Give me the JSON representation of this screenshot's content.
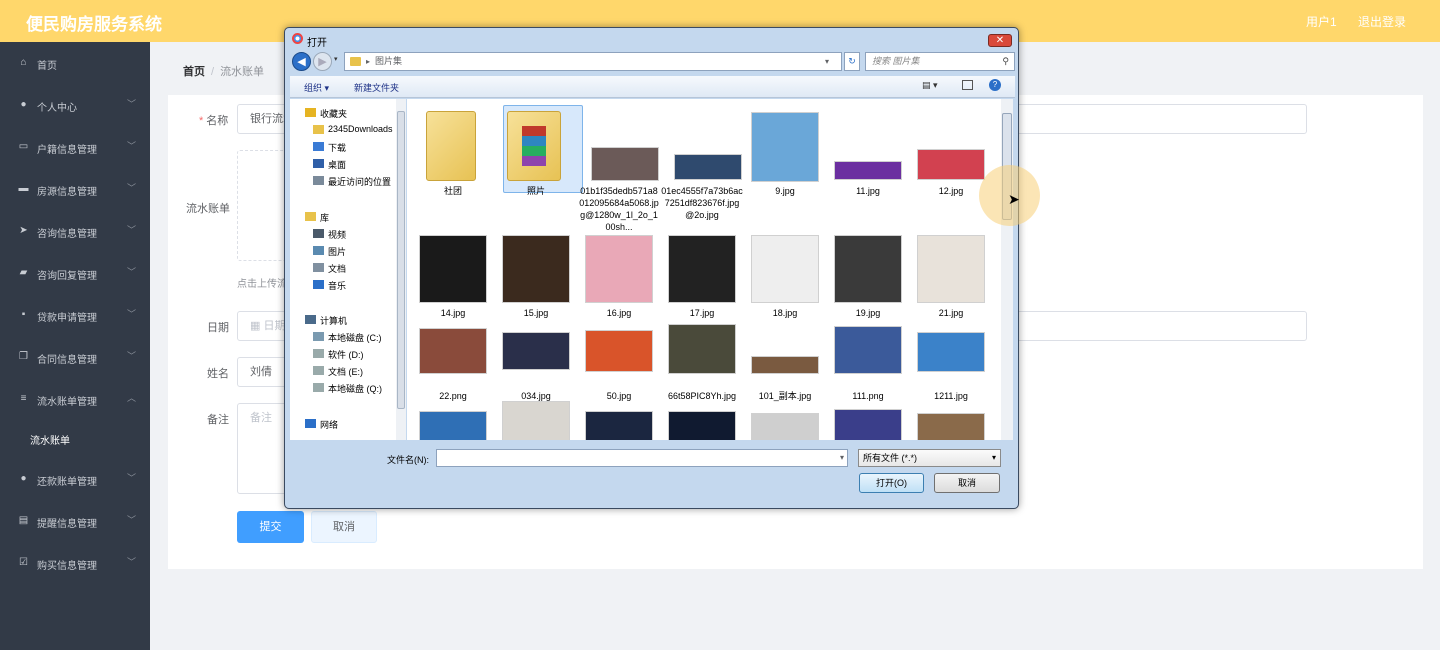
{
  "app": {
    "title": "便民购房服务系统",
    "user": "用户1",
    "logout": "退出登录"
  },
  "sidebar": {
    "items": [
      {
        "label": "首页",
        "icon": "home-icon",
        "glyph": "⌂",
        "expand": false
      },
      {
        "label": "个人中心",
        "icon": "user-icon",
        "glyph": "●",
        "expand": true
      },
      {
        "label": "户籍信息管理",
        "icon": "chat-icon",
        "glyph": "▭",
        "expand": true
      },
      {
        "label": "房源信息管理",
        "icon": "monitor-icon",
        "glyph": "▬",
        "expand": true
      },
      {
        "label": "咨询信息管理",
        "icon": "send-icon",
        "glyph": "➤",
        "expand": true
      },
      {
        "label": "咨询回复管理",
        "icon": "thumb-icon",
        "glyph": "▰",
        "expand": true
      },
      {
        "label": "贷款申请管理",
        "icon": "stamp-icon",
        "glyph": "▪",
        "expand": true
      },
      {
        "label": "合同信息管理",
        "icon": "copy-icon",
        "glyph": "❐",
        "expand": true
      },
      {
        "label": "流水账单管理",
        "icon": "menu-icon",
        "glyph": "≡",
        "expand": true
      },
      {
        "label": "还款账单管理",
        "icon": "user-icon",
        "glyph": "●",
        "expand": true
      },
      {
        "label": "提醒信息管理",
        "icon": "film-icon",
        "glyph": "▤",
        "expand": true
      },
      {
        "label": "购买信息管理",
        "icon": "checkbox-icon",
        "glyph": "☑",
        "expand": true
      }
    ],
    "sub_item": "流水账单"
  },
  "breadcrumb": {
    "home": "首页",
    "sep": "/",
    "current": "流水账单"
  },
  "form": {
    "name_label": "名称",
    "name_value": "银行流水",
    "bill_label": "流水账单",
    "upload_hint": "点击上传流水",
    "date_label": "日期",
    "date_placeholder": "日期",
    "person_label": "姓名",
    "person_value": "刘倩",
    "remark_label": "备注",
    "remark_placeholder": "备注",
    "submit": "提交",
    "cancel": "取消"
  },
  "dialog": {
    "title": "打开",
    "close": "✕",
    "address": "图片集",
    "search_placeholder": "搜索 图片集",
    "organize": "组织 ▾",
    "new_folder": "新建文件夹",
    "nav": {
      "favorites": "收藏夹",
      "fav_items": [
        "2345Downloads",
        "下载",
        "桌面",
        "最近访问的位置"
      ],
      "libraries": "库",
      "lib_items": [
        "视频",
        "图片",
        "文档",
        "音乐"
      ],
      "computer": "计算机",
      "drives": [
        "本地磁盘 (C:)",
        "软件 (D:)",
        "文档 (E:)",
        "本地磁盘 (Q:)"
      ],
      "network": "网络"
    },
    "files": [
      {
        "name": "社团",
        "kind": "folder"
      },
      {
        "name": "照片",
        "kind": "folder-winrar",
        "selected": true
      },
      {
        "name": "01b1f35dedb571a8012095684a5068.jpg@1280w_1l_2o_100sh...",
        "kind": "image",
        "color": "#6b5a58"
      },
      {
        "name": "01ec4555f7a73b6ac7251df823676f.jpg@2o.jpg",
        "kind": "image",
        "color": "#2f4a6e"
      },
      {
        "name": "9.jpg",
        "kind": "image",
        "color": "#6aa7d8"
      },
      {
        "name": "11.jpg",
        "kind": "image",
        "color": "#6b2fa0"
      },
      {
        "name": "12.jpg",
        "kind": "image",
        "color": "#d24150"
      },
      {
        "name": "14.jpg",
        "kind": "image",
        "color": "#1a1a1a"
      },
      {
        "name": "15.jpg",
        "kind": "image",
        "color": "#3b2a1e"
      },
      {
        "name": "16.jpg",
        "kind": "image",
        "color": "#e9a8b7"
      },
      {
        "name": "17.jpg",
        "kind": "image",
        "color": "#222222"
      },
      {
        "name": "18.jpg",
        "kind": "image",
        "color": "#eeeeee"
      },
      {
        "name": "19.jpg",
        "kind": "image",
        "color": "#3a3a3a"
      },
      {
        "name": "21.jpg",
        "kind": "image",
        "color": "#e8e2da"
      },
      {
        "name": "22.png",
        "kind": "image",
        "color": "#8a4b3b"
      },
      {
        "name": "034.jpg",
        "kind": "image",
        "color": "#2a2f4a"
      },
      {
        "name": "50.jpg",
        "kind": "image",
        "color": "#d9542a"
      },
      {
        "name": "66t58PIC8Yh.jpg",
        "kind": "image",
        "color": "#4a4a3a"
      },
      {
        "name": "101_副本.jpg",
        "kind": "image",
        "color": "#7a5a40"
      },
      {
        "name": "111.png",
        "kind": "image",
        "color": "#3b5a9a"
      },
      {
        "name": "1211.jpg",
        "kind": "image",
        "color": "#3b82c9"
      },
      {
        "name": "",
        "kind": "image",
        "color": "#2f6fb5"
      },
      {
        "name": "",
        "kind": "image",
        "color": "#d9d6d0"
      },
      {
        "name": "",
        "kind": "image",
        "color": "#1b2640"
      },
      {
        "name": "",
        "kind": "image",
        "color": "#101a30"
      },
      {
        "name": "",
        "kind": "image",
        "color": "#cfcfcf"
      },
      {
        "name": "",
        "kind": "image",
        "color": "#3a3e8a"
      },
      {
        "name": "",
        "kind": "image",
        "color": "#8a6a4a"
      }
    ],
    "filename_label": "文件名(N):",
    "filename_value": "",
    "filetype": "所有文件 (*.*)",
    "open": "打开(O)",
    "cancel": "取消"
  },
  "colors": {
    "topbar": "#ffd76b",
    "sidebar": "#323a47",
    "primary": "#409eff"
  }
}
